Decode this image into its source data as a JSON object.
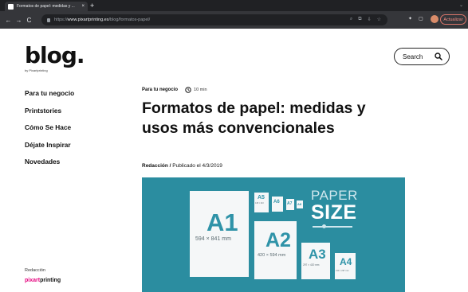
{
  "browser": {
    "tab_title": "Formatos de papel: medidas y ...",
    "tab_close": "×",
    "new_tab": "+",
    "nav": {
      "back": "←",
      "forward": "→",
      "reload": "C"
    },
    "url_scheme": "https://",
    "url_host": "www.pixartprinting.es",
    "url_path": "/blog/formatos-papel/",
    "update_label": "Actualizar",
    "icons": [
      "search-icon",
      "share-icon",
      "install-icon",
      "star-icon",
      "puzzle-icon",
      "sidebar-icon"
    ]
  },
  "site": {
    "logo": "blog.",
    "logo_tagline": "by Pixartprinting",
    "search_label": "Search"
  },
  "nav": {
    "items": [
      {
        "label": "Para tu negocio"
      },
      {
        "label": "Printstories"
      },
      {
        "label": "Cómo Se Hace"
      },
      {
        "label": "Déjate Inspirar"
      },
      {
        "label": "Novedades"
      }
    ]
  },
  "footer": {
    "label": "Redacción",
    "brand_prefix": "pixart",
    "brand_suffix": "printing",
    "brand_accent": "#e5007d"
  },
  "article": {
    "category": "Para tu negocio",
    "read_time": "10 min",
    "title": "Formatos de papel: medidas y usos más convencionales",
    "author": "Redacción /",
    "published": " Publicado el 4/3/2019",
    "hero": {
      "background": "#2b8da0",
      "word_paper": "PAPER",
      "word_size": "SIZE",
      "sheets": [
        {
          "label": "A1",
          "dim": "594 × 841 mm"
        },
        {
          "label": "A2",
          "dim": "420 × 594 mm"
        },
        {
          "label": "A3",
          "dim": "297 × 420 mm"
        },
        {
          "label": "A4",
          "dim": "210 × 297 mm"
        },
        {
          "label": "A5",
          "dim": "148 × 210"
        },
        {
          "label": "A6",
          "dim": ""
        },
        {
          "label": "A7",
          "dim": ""
        },
        {
          "label": "A8",
          "dim": ""
        }
      ]
    }
  }
}
